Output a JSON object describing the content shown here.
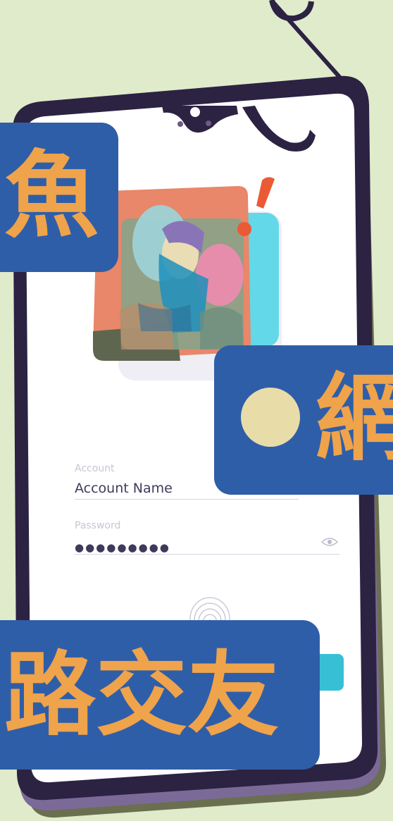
{
  "login_form": {
    "account_label": "Account",
    "account_value": "Account Name",
    "password_label": "Password",
    "password_value": "●●●●●●●●●",
    "eye_icon": "eye-icon",
    "fingerprint_icon": "fingerprint-icon"
  },
  "overlay_titles": {
    "fish": "魚",
    "net": "網",
    "friend": "路交友"
  },
  "colors": {
    "background": "#dfebcb",
    "phone_frame": "#2c2242",
    "screen": "#ffffff",
    "tile": "#2f5ea8",
    "tile_text": "#efa34a",
    "alert": "#ea5a35"
  }
}
